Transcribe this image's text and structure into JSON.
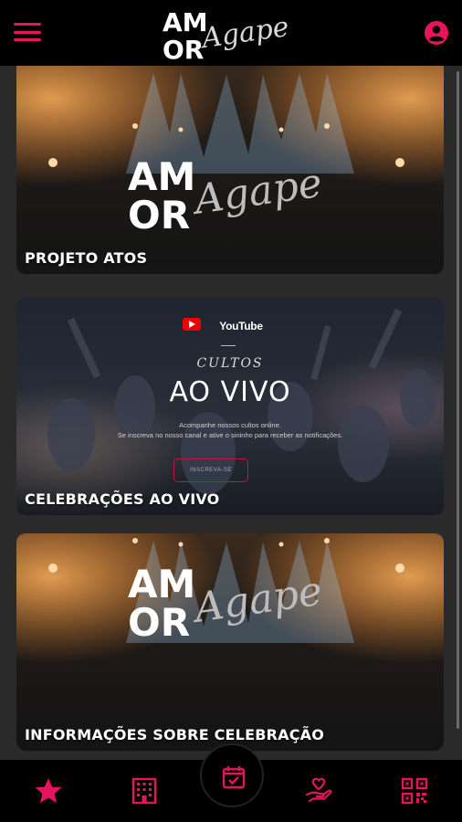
{
  "header": {
    "menu_icon": "hamburger-menu-icon",
    "profile_icon": "account-circle-icon",
    "logo": {
      "word1": "AM",
      "word2": "OR",
      "script": "Agape"
    }
  },
  "cards": [
    {
      "title": "PROJETO ATOS",
      "image": "amor-agape-stage-lights"
    },
    {
      "title": "CELEBRAÇÕES AO VIVO",
      "image": "youtube-cultos-ao-vivo",
      "youtube_label": "YouTube",
      "cultos_label": "CULTOS",
      "aovivo_label": "AO VIVO",
      "description_line1": "Acompanhe nossos cultos online.",
      "description_line2": "Se inscreva no nosso canal e ative o sininho para receber as notificações.",
      "subscribe_label": "INSCREVA-SE"
    },
    {
      "title": "INFORMAÇÕES SOBRE CELEBRAÇÃO",
      "image": "amor-agape-stage-lights"
    }
  ],
  "bottom_nav": [
    {
      "icon": "star-icon"
    },
    {
      "icon": "building-icon"
    },
    {
      "icon": "calendar-check-icon"
    },
    {
      "icon": "hand-heart-icon"
    },
    {
      "icon": "qr-code-icon"
    }
  ],
  "colors": {
    "accent": "#e6135e",
    "header_bg": "#000000",
    "page_bg": "#2a2a2a"
  }
}
